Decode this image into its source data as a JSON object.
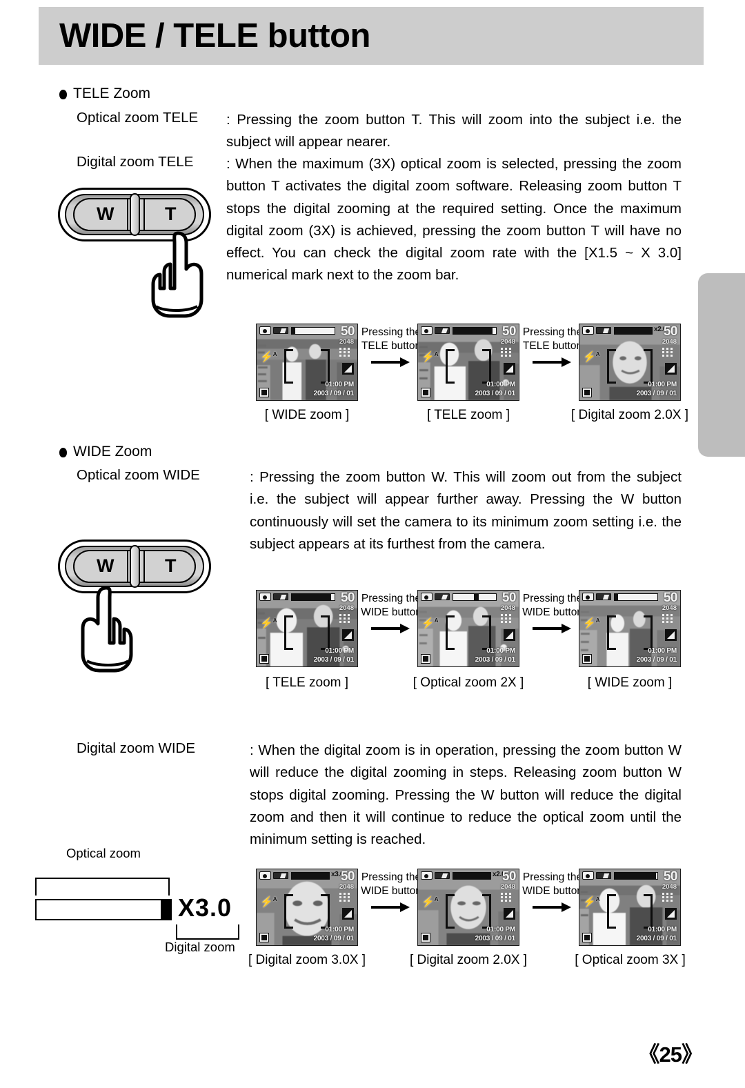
{
  "page": {
    "title": "WIDE / TELE button",
    "number": "《25》"
  },
  "sections": [
    {
      "heading": "TELE Zoom",
      "terms": [
        {
          "label": "Optical zoom TELE",
          "text": ": Pressing the zoom button T. This will zoom into the subject i.e. the subject will appear nearer."
        },
        {
          "label": "Digital zoom TELE",
          "text": ": When the maximum (3X) optical zoom is selected, pressing the zoom button T activates the digital zoom software. Releasing zoom button T stops the digital zooming at the required setting. Once the maximum digital zoom (3X) is achieved, pressing the zoom button T will have no effect. You can check the digital zoom rate with the [X1.5 ~ X 3.0] numerical mark next to the zoom bar."
        }
      ]
    },
    {
      "heading": "WIDE Zoom",
      "terms": [
        {
          "label": "Optical zoom WIDE",
          "text": ": Pressing the zoom button W. This will zoom out from the subject i.e. the subject will appear further away. Pressing the W button continuously will set the camera to its minimum zoom setting i.e. the subject appears at its furthest from the camera."
        },
        {
          "label": "Digital zoom WIDE",
          "text": ": When the digital zoom is in operation, pressing the zoom button W will reduce the digital zooming in steps. Releasing zoom button W stops digital zooming. Pressing the W button will reduce the digital zoom and then it will continue to reduce the optical zoom until the minimum setting is reached."
        }
      ]
    }
  ],
  "buttons": [
    {
      "wide_label": "W",
      "tele_label": "T",
      "pressed": "T"
    },
    {
      "wide_label": "W",
      "tele_label": "T",
      "pressed": "W"
    }
  ],
  "lcd_common": {
    "shot_count": "50",
    "resolution": "2048",
    "time": "01:00 PM",
    "date": "2003 / 09 / 01"
  },
  "flows": [
    {
      "id": "tele-flow",
      "steps": [
        {
          "caption": "[ WIDE zoom ]",
          "zoom_fill_pct": 8,
          "zoom_text": ""
        },
        {
          "caption": "[ TELE zoom ]",
          "zoom_fill_pct": 92,
          "zoom_text": ""
        },
        {
          "caption": "[ Digital zoom 2.0X ]",
          "zoom_fill_pct": 100,
          "zoom_text": "x2.0"
        }
      ],
      "transitions": [
        {
          "line1": "Pressing the",
          "line2": "TELE button",
          "arrow": "arrow-right"
        },
        {
          "line1": "Pressing the",
          "line2": "TELE button",
          "arrow": "arrow-right"
        }
      ]
    },
    {
      "id": "wide-flow",
      "steps": [
        {
          "caption": "[ TELE zoom ]",
          "zoom_fill_pct": 92,
          "zoom_text": ""
        },
        {
          "caption": "[ Optical zoom 2X ]",
          "zoom_fill_pct": 52,
          "zoom_text": ""
        },
        {
          "caption": "[ WIDE zoom ]",
          "zoom_fill_pct": 8,
          "zoom_text": ""
        }
      ],
      "transitions": [
        {
          "line1": "Pressing the",
          "line2": "WIDE button",
          "arrow": "arrow-right"
        },
        {
          "line1": "Pressing the",
          "line2": "WIDE button",
          "arrow": "arrow-right"
        }
      ]
    },
    {
      "id": "digital-wide-flow",
      "steps": [
        {
          "caption": "[ Digital zoom 3.0X ]",
          "zoom_fill_pct": 100,
          "zoom_text": "x3.0"
        },
        {
          "caption": "[ Digital zoom 2.0X ]",
          "zoom_fill_pct": 100,
          "zoom_text": "x2.0"
        },
        {
          "caption": "[ Optical zoom 3X ]",
          "zoom_fill_pct": 96,
          "zoom_text": ""
        }
      ],
      "transitions": [
        {
          "line1": "Pressing the",
          "line2": "WIDE button",
          "arrow": "arrow-right"
        },
        {
          "line1": "Pressing the",
          "line2": "WIDE button",
          "arrow": "arrow-right"
        }
      ]
    }
  ],
  "zoom_diagram": {
    "optical_label": "Optical zoom",
    "digital_label": "Digital zoom",
    "value": "X3.0"
  }
}
